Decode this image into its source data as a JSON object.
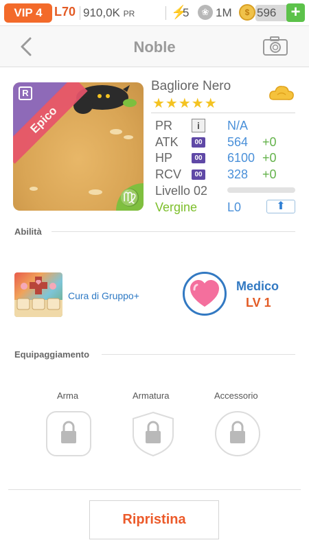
{
  "status_bar": {
    "vip": "VIP 4",
    "level": "L70",
    "power": "910,0K",
    "power_unit": "PR",
    "energy": "5",
    "paws": "1M",
    "coins": "596",
    "add_label": "+"
  },
  "nav": {
    "title": "Noble"
  },
  "pet": {
    "rarity": "Epico",
    "card_corner": "R",
    "name": "Bagliore Nero",
    "stars": "★★★★★",
    "star_count": 5,
    "stats": [
      {
        "label": "PR",
        "value": "N/A",
        "bonus": ""
      },
      {
        "label": "ATK",
        "badge": "00",
        "value": "564",
        "bonus": "+0"
      },
      {
        "label": "HP",
        "badge": "00",
        "value": "6100",
        "bonus": "+0"
      },
      {
        "label": "RCV",
        "badge": "00",
        "value": "328",
        "bonus": "+0"
      }
    ],
    "level_label": "Livello 02",
    "level_progress": 0.0,
    "sign": "Vergine",
    "sign_level": "L0",
    "upgrade_icon": "arrow-up-icon"
  },
  "sections": {
    "ability": "Abilità",
    "equipment": "Equipaggiamento"
  },
  "ability": {
    "name": "Cura di Gruppo+",
    "role": "Medico",
    "role_level": "LV 1"
  },
  "equipment": {
    "slots": [
      {
        "label": "Arma"
      },
      {
        "label": "Armatura"
      },
      {
        "label": "Accessorio"
      }
    ]
  },
  "footer": {
    "reset_label": "Ripristina"
  },
  "colors": {
    "accent_orange": "#f36a2a",
    "link_blue": "#4a90d9",
    "bonus_green": "#63b24a",
    "star_yellow": "#f4c321"
  }
}
